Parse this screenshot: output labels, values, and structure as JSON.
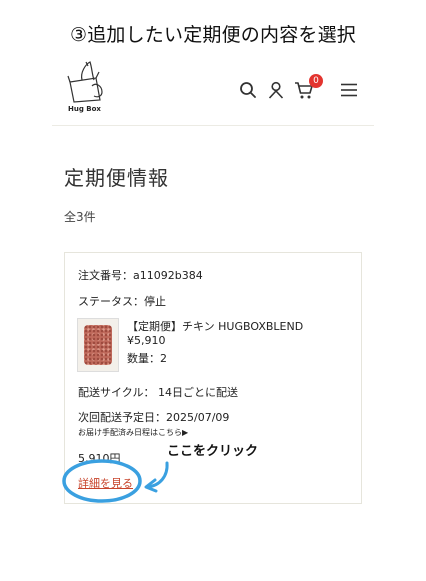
{
  "step_title": "③追加したい定期便の内容を選択",
  "header": {
    "logo_text": "Hug Box",
    "icons": [
      "search-icon",
      "user-icon",
      "cart-icon",
      "menu-icon"
    ],
    "cart_badge": "0",
    "colors": {
      "badge": "#e3342f",
      "divider": "#ecebe4"
    }
  },
  "page": {
    "heading": "定期便情報",
    "count": "全3件"
  },
  "order": {
    "order_number": "注文番号：a11092b384",
    "status": "ステータス：停止",
    "product_name": "【定期便】チキン HUGBOXBLEND",
    "price": "¥5,910",
    "quantity": "数量：2",
    "delivery_cycle": "配送サイクル： 14日ごとに配送",
    "next_delivery": "次回配送予定日：2025/07/09",
    "schedule_link": "お届け手配済み日程はこちら▶",
    "total": "5,910円",
    "detail_link": "詳細を見る"
  },
  "annotation": {
    "text": "ここをクリック",
    "color": "#3aa0e0"
  }
}
